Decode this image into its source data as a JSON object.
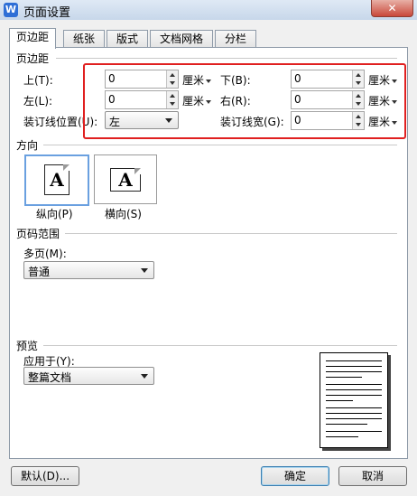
{
  "window": {
    "title": "页面设置",
    "app_icon": "W",
    "close": "✕"
  },
  "tabs": [
    {
      "label": "页边距",
      "active": true
    },
    {
      "label": "纸张",
      "active": false
    },
    {
      "label": "版式",
      "active": false
    },
    {
      "label": "文档网格",
      "active": false
    },
    {
      "label": "分栏",
      "active": false
    }
  ],
  "margins": {
    "section_title": "页边距",
    "top": {
      "label": "上(T):",
      "value": "0",
      "unit": "厘米"
    },
    "bottom": {
      "label": "下(B):",
      "value": "0",
      "unit": "厘米"
    },
    "left": {
      "label": "左(L):",
      "value": "0",
      "unit": "厘米"
    },
    "right": {
      "label": "右(R):",
      "value": "0",
      "unit": "厘米"
    },
    "gutter_position": {
      "label": "装订线位置(U):",
      "value": "左"
    },
    "gutter": {
      "label": "装订线宽(G):",
      "value": "0",
      "unit": "厘米"
    }
  },
  "orientation": {
    "section_title": "方向",
    "portrait": {
      "label": "纵向(P)",
      "glyph": "A",
      "selected": true
    },
    "landscape": {
      "label": "横向(S)",
      "glyph": "A",
      "selected": false
    }
  },
  "page_range": {
    "section_title": "页码范围",
    "multiple_label": "多页(M):",
    "multiple_value": "普通"
  },
  "preview": {
    "section_title": "预览",
    "apply_label": "应用于(Y):",
    "apply_value": "整篇文档"
  },
  "buttons": {
    "default": "默认(D)...",
    "ok": "确定",
    "cancel": "取消"
  },
  "colors": {
    "highlight_box": "#e02020",
    "selected_border": "#6aa0e0"
  }
}
